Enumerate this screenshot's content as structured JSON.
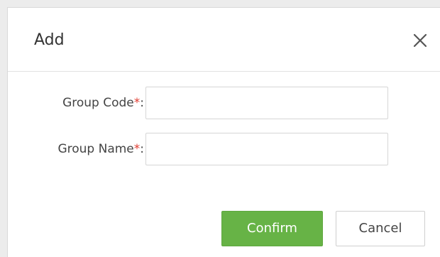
{
  "dialog": {
    "title": "Add",
    "close_icon": "close-icon"
  },
  "form": {
    "group_code": {
      "label": "Group Code",
      "required_mark": "*",
      "suffix": ":",
      "value": ""
    },
    "group_name": {
      "label": "Group Name",
      "required_mark": "*",
      "suffix": ":",
      "value": ""
    }
  },
  "buttons": {
    "confirm_label": "Confirm",
    "cancel_label": "Cancel"
  },
  "colors": {
    "confirm_bg": "#67b346",
    "required": "#e03c31"
  }
}
